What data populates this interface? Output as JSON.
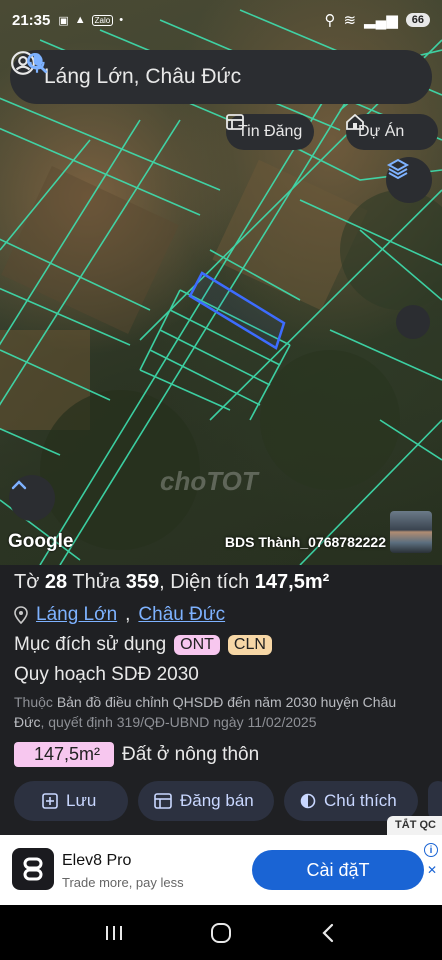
{
  "status_bar": {
    "time": "21:35",
    "notif_label": "Zalo",
    "battery": "66"
  },
  "search": {
    "query": "Láng Lớn, Châu Đức"
  },
  "chips": {
    "listings": "Tin Đăng",
    "projects": "Dự Án"
  },
  "map": {
    "brand": "Google",
    "owner_name": "BDS Thành_0768782222",
    "watermark": "choTOT"
  },
  "parcel": {
    "sheet_label": "Tờ",
    "sheet_no": "28",
    "plot_label": "Thửa",
    "plot_no": "359",
    "area_label": "Diện tích",
    "area": "147,5m²",
    "ward": "Láng Lớn",
    "district": "Châu Đức",
    "purpose_label": "Mục đích sử dụng",
    "tags": [
      "ONT",
      "CLN"
    ],
    "plan_label": "Quy hoạch SDĐ 2030",
    "note_prefix": "Thuộc",
    "note_link": "Bản đồ điều chỉnh QHSDĐ đến năm 2030 huyện Châu Đức",
    "note_suffix": ", quyết định 319/QĐ-UBND ngày 11/02/2025",
    "area_pill": "147,5m²",
    "land_type": "Đất ở nông thôn"
  },
  "actions": {
    "save": "Lưu",
    "sell": "Đăng bán",
    "legend": "Chú thích"
  },
  "ad": {
    "close_label": "TẮT QC",
    "app_name": "Elev8 Pro",
    "tagline": "Trade more, pay less",
    "install": "Cài đặT"
  },
  "colors": {
    "parcel_line": "#3ee0b0",
    "selected_parcel": "#3d6cff",
    "panel_bg": "#1f2023",
    "link": "#7eb2ff",
    "ont_tag": "#f7c7ef",
    "cln_tag": "#f7d7a6",
    "install_btn": "#1a64d4"
  }
}
